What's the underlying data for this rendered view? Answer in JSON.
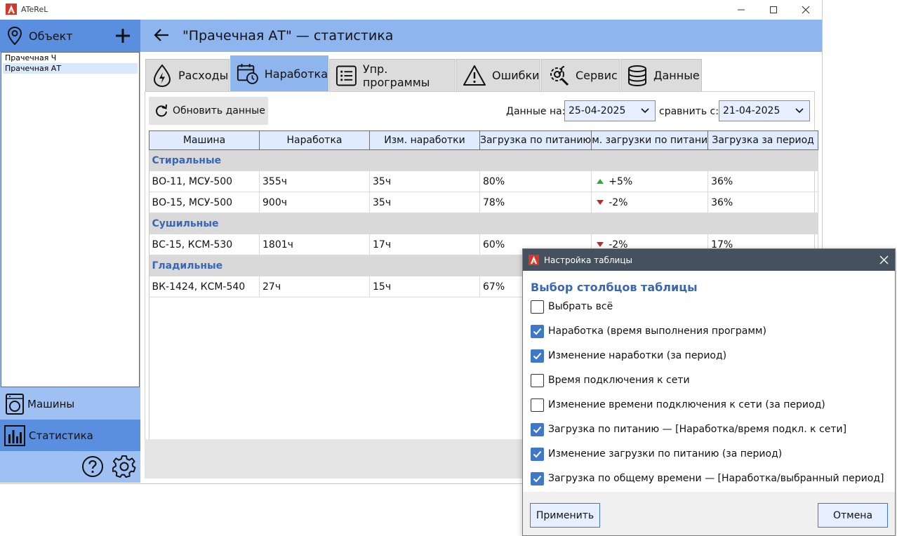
{
  "app": {
    "title": "ATeReL"
  },
  "sidebar": {
    "header_label": "Объект",
    "objects": [
      "Прачечная Ч",
      "Прачечная АТ"
    ],
    "nav": [
      {
        "label": "Машины",
        "icon": "washing-machine-icon"
      },
      {
        "label": "Статистика",
        "icon": "bar-chart-icon"
      }
    ]
  },
  "header": {
    "title": "\"Прачечная АТ\" — статистика"
  },
  "tabs": [
    {
      "label": "Расходы",
      "icon": "drop-icon"
    },
    {
      "label": "Наработка",
      "icon": "calendar-clock-icon"
    },
    {
      "label": "Упр. программы",
      "icon": "list-icon"
    },
    {
      "label": "Ошибки",
      "icon": "warning-icon"
    },
    {
      "label": "Сервис",
      "icon": "service-gear-icon"
    },
    {
      "label": "Данные",
      "icon": "database-icon"
    }
  ],
  "toolbar": {
    "refresh_label": "Обновить данные",
    "date_label": "Данные на:",
    "date_value": "25-04-2025",
    "compare_label": "сравнить с:",
    "compare_value": "21-04-2025"
  },
  "table": {
    "columns": [
      "Машина",
      "Наработка",
      "Изм. наработки",
      "Загрузка по питанию",
      "м. загрузки по питани",
      "Загрузка за период"
    ],
    "groups": [
      {
        "name": "Стиральные",
        "rows": [
          {
            "machine": "ВО-11, МСУ-500",
            "runtime": "355ч",
            "runtime_change": "35ч",
            "power_load": "80%",
            "load_change": "+5%",
            "trend": "up",
            "period_load": "36%"
          },
          {
            "machine": "ВО-15, МСУ-500",
            "runtime": "900ч",
            "runtime_change": "35ч",
            "power_load": "78%",
            "load_change": "-2%",
            "trend": "down",
            "period_load": "36%"
          }
        ]
      },
      {
        "name": "Сушильные",
        "rows": [
          {
            "machine": "ВС-15, КСМ-530",
            "runtime": "1801ч",
            "runtime_change": "17ч",
            "power_load": "60%",
            "load_change": "-2%",
            "trend": "down",
            "period_load": "17%"
          }
        ]
      },
      {
        "name": "Гладильные",
        "rows": [
          {
            "machine": "ВК-1424, КСМ-540",
            "runtime": "27ч",
            "runtime_change": "15ч",
            "power_load": "67%",
            "load_change": "",
            "trend": "",
            "period_load": ""
          }
        ]
      }
    ]
  },
  "dialog": {
    "title": "Настройка таблицы",
    "heading": "Выбор столбцов таблицы",
    "options": [
      {
        "label": "Выбрать всё",
        "checked": false
      },
      {
        "label": "Наработка (время выполнения программ)",
        "checked": true
      },
      {
        "label": "Изменение наработки (за период)",
        "checked": true
      },
      {
        "label": "Время подключения к сети",
        "checked": false
      },
      {
        "label": "Изменение времени подключения к сети (за период)",
        "checked": false
      },
      {
        "label": "Загрузка по питанию — [Наработка/время подкл. к сети]",
        "checked": true
      },
      {
        "label": "Изменение загрузки по питанию (за период)",
        "checked": true
      },
      {
        "label": "Загрузка по общему времени — [Наработка/выбранный период]",
        "checked": true
      }
    ],
    "apply_label": "Применить",
    "cancel_label": "Отмена"
  },
  "colors": {
    "accent": "#5a8fe0",
    "header": "#8fb5ef",
    "group_text": "#3a67b5",
    "up": "#2fa834",
    "down": "#c0262b"
  }
}
